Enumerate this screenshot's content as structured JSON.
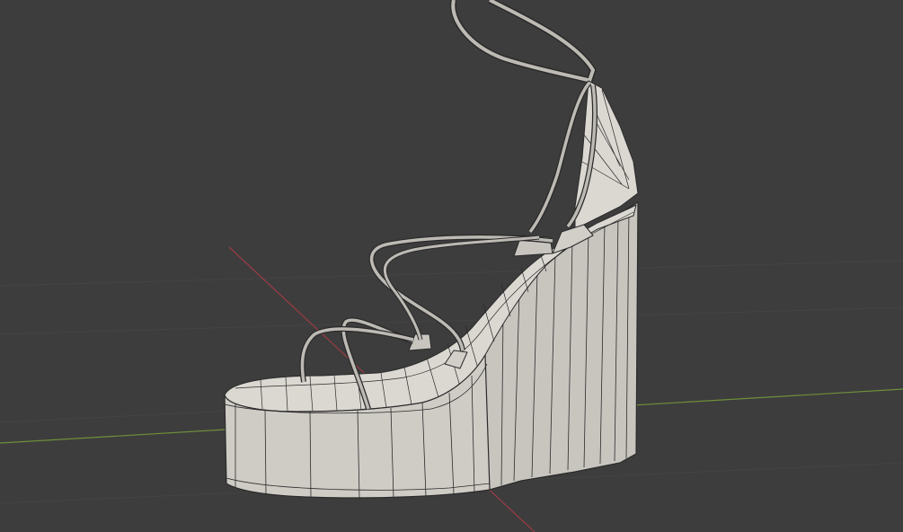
{
  "viewport": {
    "background": "#3d3d3d",
    "grid_line_color": "#444444",
    "x_axis_color": "#9a3b45",
    "y_axis_color": "#6e8f3a",
    "mesh_fill": "#c8c5bf",
    "mesh_fill_light": "#dbd8d2",
    "mesh_fill_shadow": "#aeaba5",
    "wire_color": "#2b2b2b",
    "display_mode": "solid-with-wireframe",
    "object": "wedge-sandal-mesh"
  }
}
